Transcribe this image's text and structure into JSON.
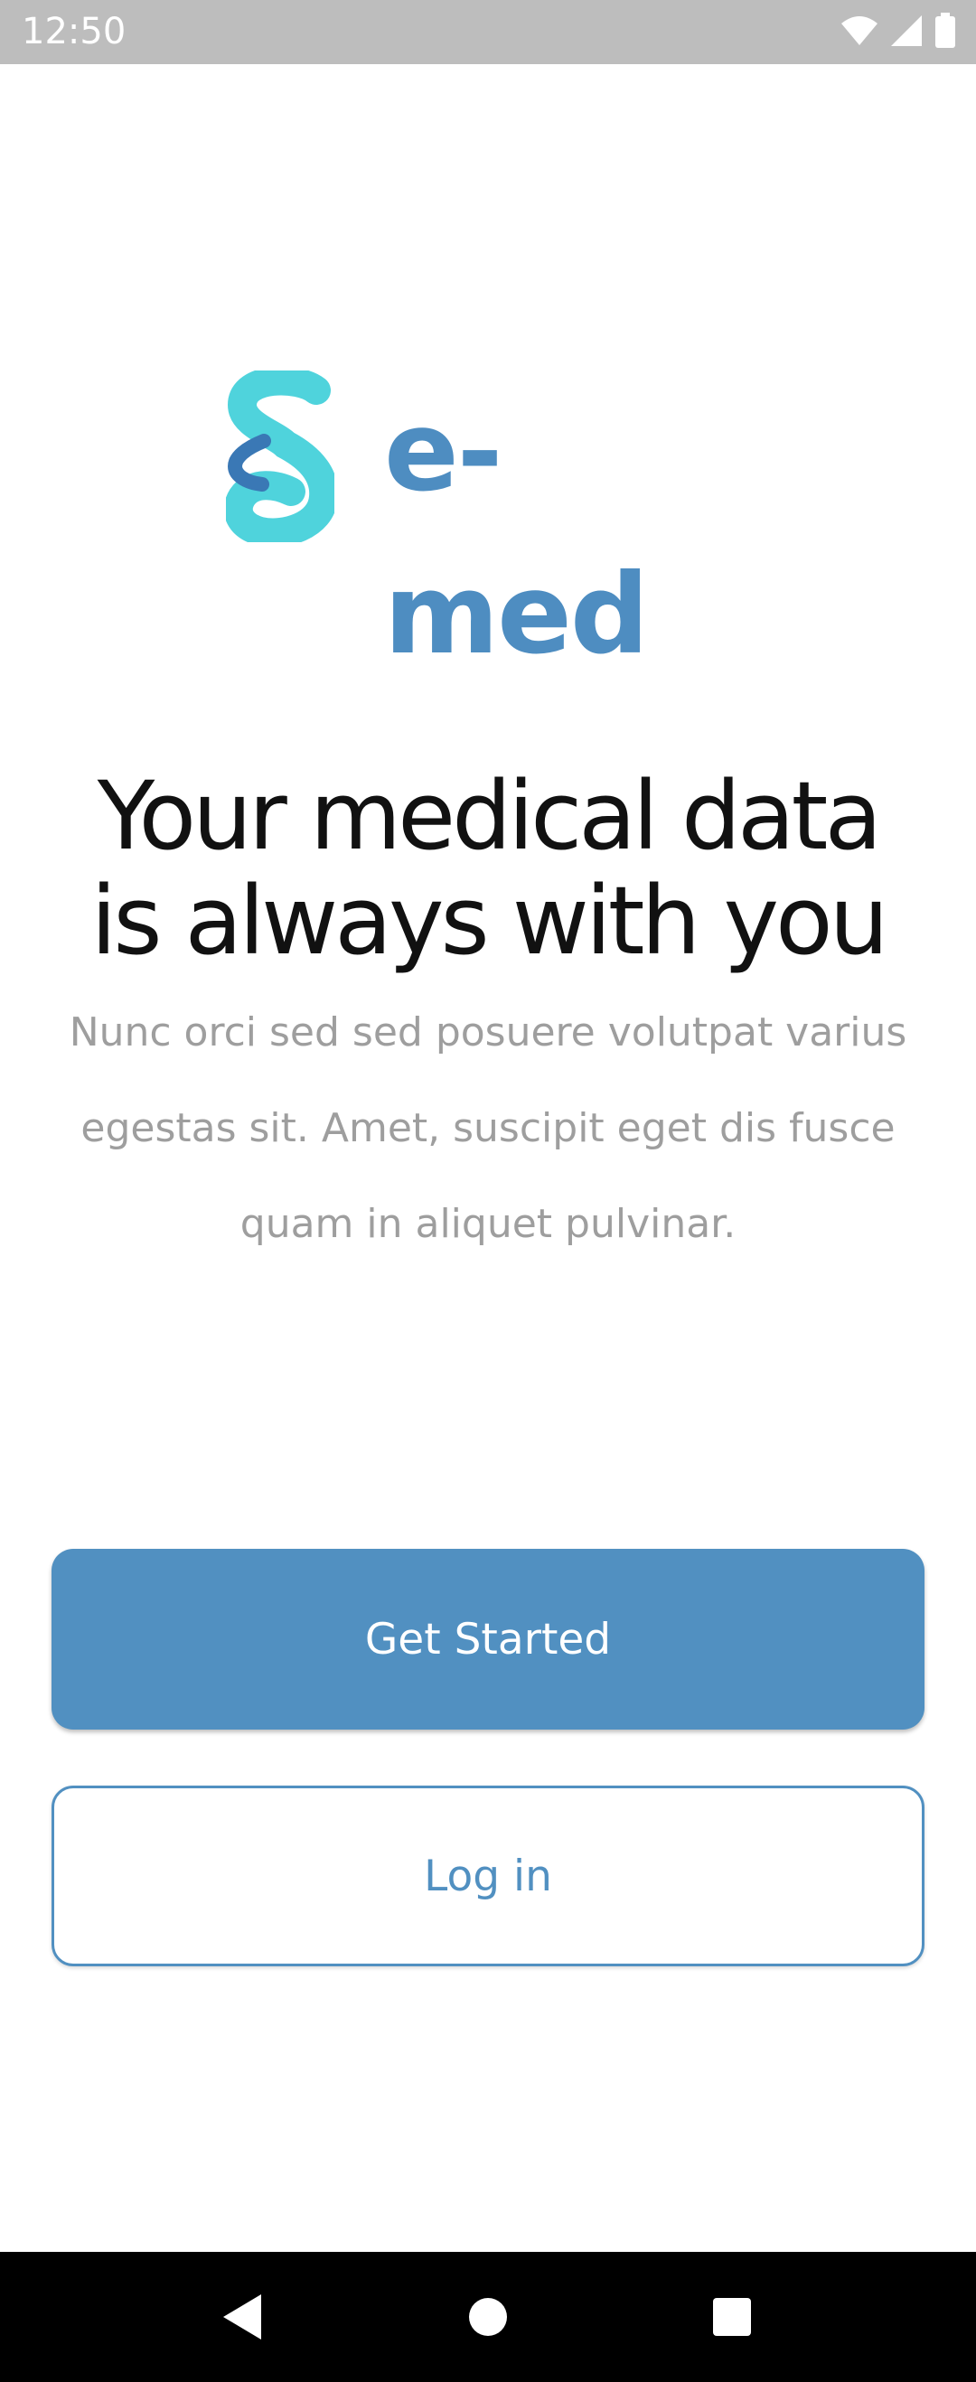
{
  "status_bar": {
    "time": "12:50",
    "icons": [
      "wifi-icon",
      "signal-icon",
      "battery-icon"
    ]
  },
  "logo": {
    "text": "e-med",
    "icon": "emed-logo-icon"
  },
  "headline": {
    "line1": "Your medical data",
    "line2": "is always with you"
  },
  "description": "Nunc orci sed sed posuere volutpat varius egestas sit. Amet, suscipit eget dis fusce quam in aliquet pulvinar.",
  "buttons": {
    "get_started": "Get Started",
    "log_in": "Log in"
  },
  "nav_bar": {
    "icons": [
      "back-icon",
      "home-icon",
      "recents-icon"
    ]
  },
  "colors": {
    "primary": "#5190c1",
    "logo_text": "#4e8dc1",
    "logo_icon": "#4fd3dc",
    "logo_icon_inner": "#3a78b5",
    "description": "#9e9e9e",
    "status_bar": "#bdbdbd"
  }
}
